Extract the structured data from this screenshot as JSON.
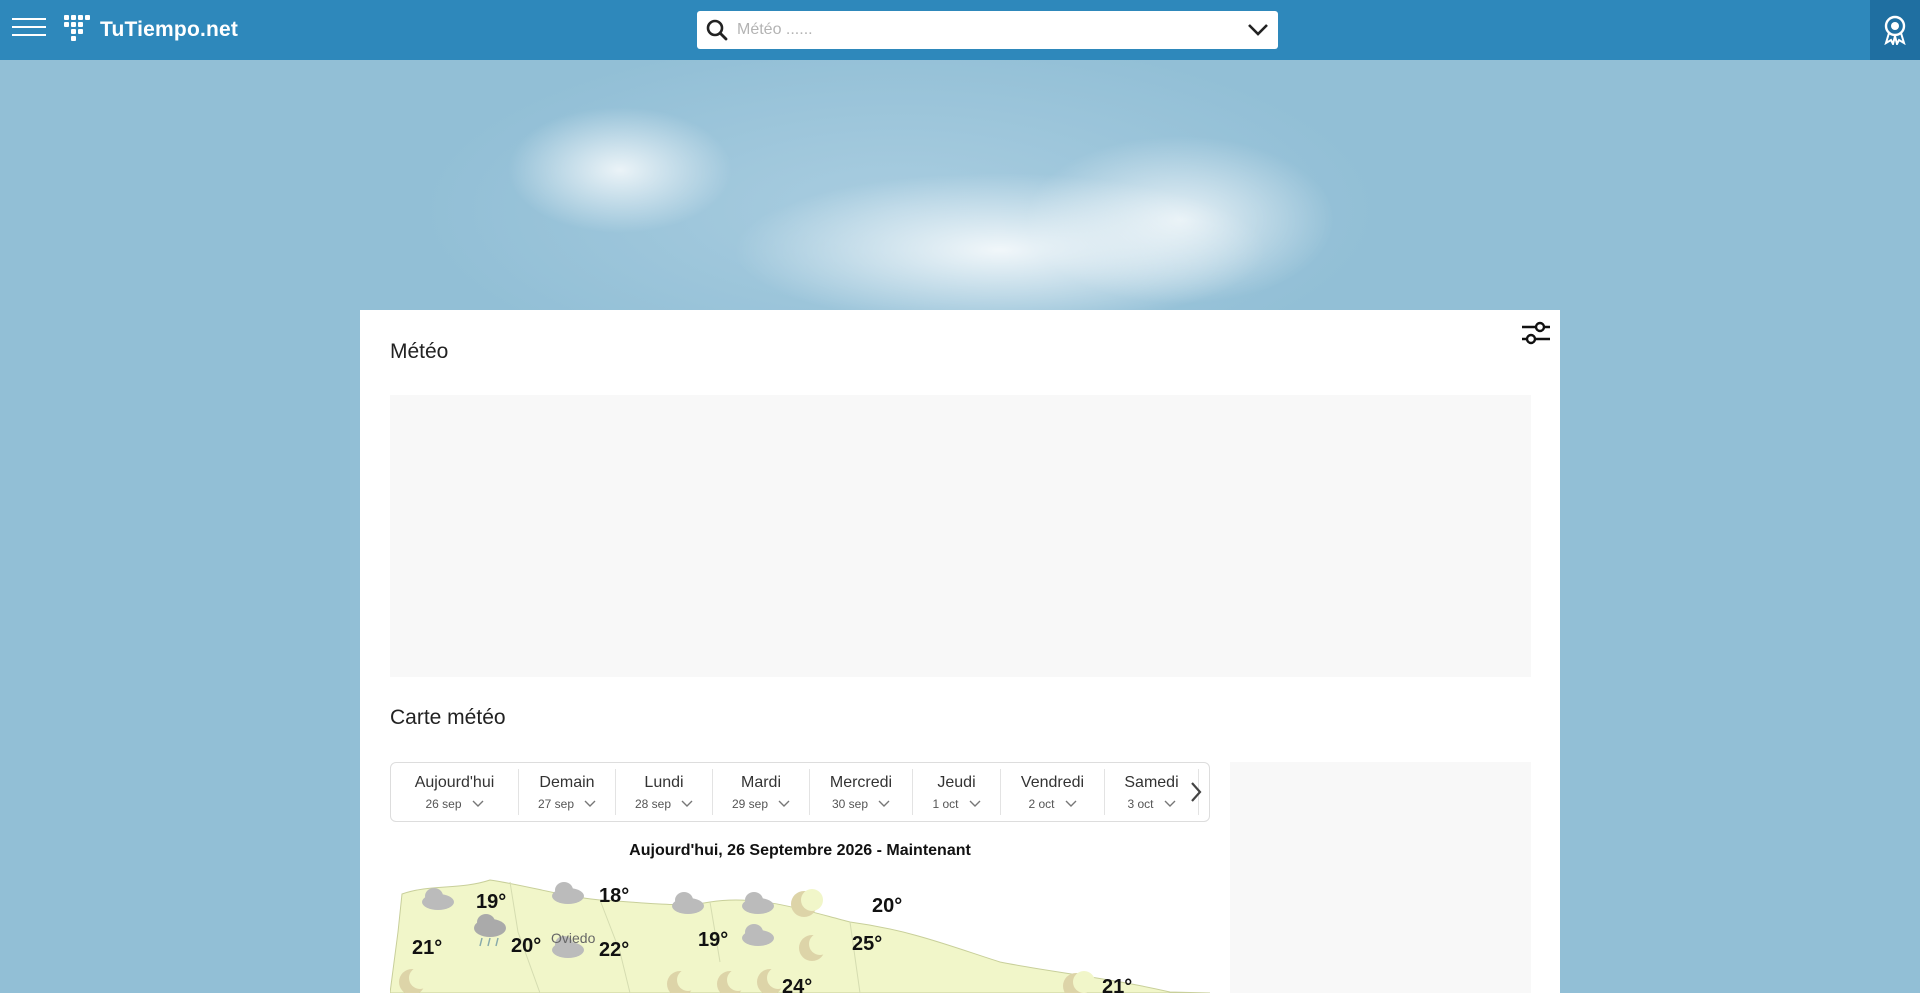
{
  "header": {
    "logo_text": "TuTiempo.net",
    "search_placeholder": "Météo ......"
  },
  "main": {
    "title": "Météo",
    "map_section_title": "Carte météo",
    "days": [
      {
        "name": "Aujourd'hui",
        "date": "26 sep"
      },
      {
        "name": "Demain",
        "date": "27 sep"
      },
      {
        "name": "Lundi",
        "date": "28 sep"
      },
      {
        "name": "Mardi",
        "date": "29 sep"
      },
      {
        "name": "Mercredi",
        "date": "30 sep"
      },
      {
        "name": "Jeudi",
        "date": "1 oct"
      },
      {
        "name": "Vendredi",
        "date": "2 oct"
      },
      {
        "name": "Samedi",
        "date": "3 oct"
      }
    ],
    "map_caption": "Aujourd'hui, 26 Septembre 2026 - Maintenant",
    "map": {
      "city_labels": [
        "Oviedo"
      ],
      "temperatures": [
        "19°",
        "18°",
        "20°",
        "20°",
        "21°",
        "22°",
        "19°",
        "25°",
        "24°",
        "21°"
      ]
    }
  },
  "colors": {
    "topbar": "#2e88bb",
    "award_bg": "#1f6fa1",
    "background": "#92bfd6",
    "map_land": "#f1f6c9"
  }
}
